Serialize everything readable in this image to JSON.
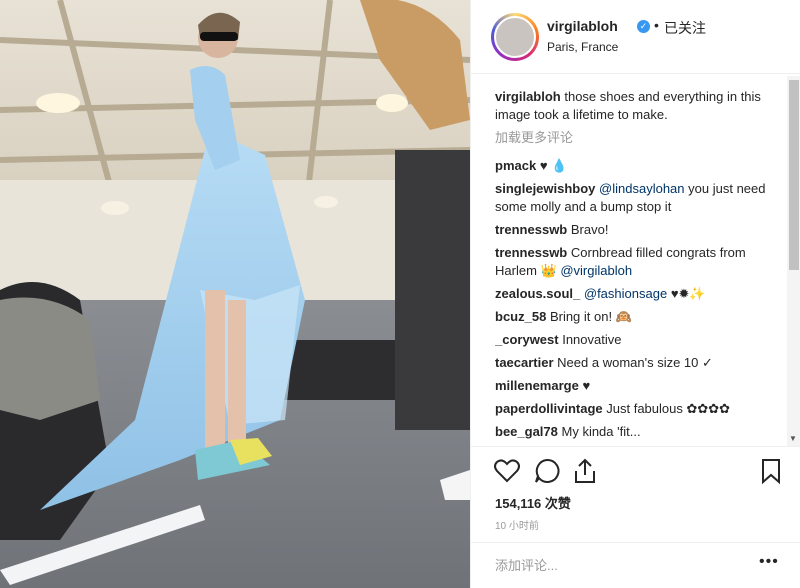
{
  "post": {
    "username": "virgilabloh",
    "verified_mark": "✓",
    "follow_separator": "•",
    "follow_status": "已关注",
    "location": "Paris, France",
    "caption_user": "virgilabloh",
    "caption_text": "those shoes and everything in this image took a lifetime to make.",
    "load_more": "加载更多评论",
    "likes": "154,116 次赞",
    "time": "10 小时前",
    "add_comment_placeholder": "添加评论...",
    "more_menu": "•••"
  },
  "comments": [
    {
      "user": "pmack",
      "text": "♥ 💧"
    },
    {
      "user": "singlejewishboy",
      "mention": "@lindsaylohan",
      "text": "you just need some molly and a bump stop it"
    },
    {
      "user": "trennesswb",
      "text": "Bravo!"
    },
    {
      "user": "trennesswb",
      "text": "Cornbread filled congrats from Harlem 👑",
      "mention": "@virgilabloh"
    },
    {
      "user": "zealous.soul_",
      "mention": "@fashionsage",
      "text": "♥✹✨"
    },
    {
      "user": "bcuz_58",
      "text": "Bring it on! 🙉"
    },
    {
      "user": "_corywest",
      "text": "Innovative"
    },
    {
      "user": "taecartier",
      "text": "Need a woman's size 10 ✓"
    },
    {
      "user": "millenemarge",
      "text": "♥"
    },
    {
      "user": "paperdollivintage",
      "text": "Just fabulous ✿✿✿✿"
    },
    {
      "user": "bee_gal78",
      "text": "My kinda 'fit..."
    }
  ],
  "icons": [
    "heart-icon",
    "comment-icon",
    "share-icon",
    "bookmark-icon",
    "verified-badge-icon"
  ],
  "colors": {
    "verified": "#3897f0",
    "mention": "#003569",
    "muted": "#999999",
    "dress": "#a9d1ef"
  }
}
